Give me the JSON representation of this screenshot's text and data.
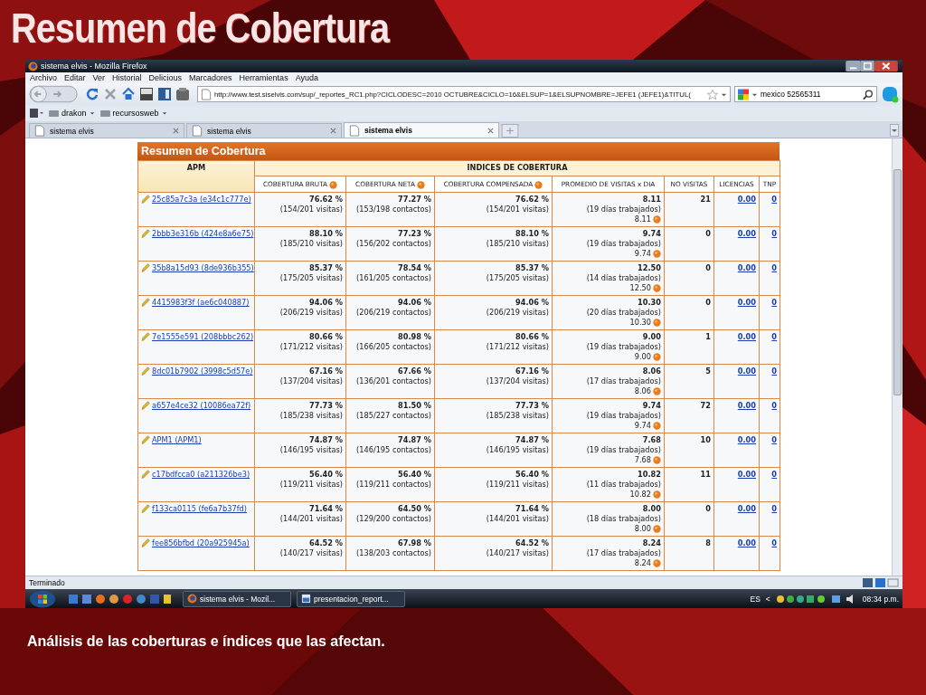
{
  "slide_title": "Resumen de Cobertura",
  "caption": "Análisis de las coberturas e índices que las afectan.",
  "browser": {
    "window_title": "sistema elvis - Mozilla Firefox",
    "menu": [
      "Archivo",
      "Editar",
      "Ver",
      "Historial",
      "Delicious",
      "Marcadores",
      "Herramientas",
      "Ayuda"
    ],
    "url": "http://www.test.siselvis.com/sup/_reportes_RC1.php?CICLODESC=2010 OCTUBRE&CICLO=16&ELSUP=1&ELSUPNOMBRE=JEFE1 (JEFE1)&TITUL(",
    "search": "mexico 52565311",
    "bookmarks": [
      "drakon",
      "recursosweb"
    ],
    "tabs": [
      {
        "label": "sistema elvis",
        "selected": false
      },
      {
        "label": "sistema elvis",
        "selected": false
      },
      {
        "label": "sistema elvis",
        "selected": true
      }
    ],
    "status": "Terminado"
  },
  "report": {
    "title": "Resumen de Cobertura",
    "apm_header": "APM",
    "group_header": "INDICES DE COBERTURA",
    "columns": [
      {
        "label": "COBERTURA BRUTA",
        "info": true
      },
      {
        "label": "COBERTURA NETA",
        "info": true
      },
      {
        "label": "COBERTURA COMPENSADA",
        "info": true
      },
      {
        "label": "PROMEDIO DE VISITAS x DIA",
        "info": false
      },
      {
        "label": "NO VISITAS",
        "info": false
      },
      {
        "label": "LICENCIAS",
        "info": false
      },
      {
        "label": "TNP",
        "info": false
      }
    ],
    "rows": [
      {
        "apm": "25c85a7c3a (e34c1c777e)",
        "bruta": "76.62 %",
        "bruta_detail": "(154/201 visitas)",
        "neta": "77.27 %",
        "neta_detail": "(153/198 contactos)",
        "compensada": "76.62 %",
        "compensada_detail": "(154/201 visitas)",
        "promedio": "8.11",
        "dias": "(19 días trabajados)",
        "promedio_repeat": "8.11",
        "no_visitas": "21",
        "licencias": "0.00",
        "tnp": "0"
      },
      {
        "apm": "2bbb3e316b (424e8a6e75)",
        "bruta": "88.10 %",
        "bruta_detail": "(185/210 visitas)",
        "neta": "77.23 %",
        "neta_detail": "(156/202 contactos)",
        "compensada": "88.10 %",
        "compensada_detail": "(185/210 visitas)",
        "promedio": "9.74",
        "dias": "(19 días trabajados)",
        "promedio_repeat": "9.74",
        "no_visitas": "0",
        "licencias": "0.00",
        "tnp": "0"
      },
      {
        "apm": "35b8a15d93 (8de936b355)",
        "bruta": "85.37 %",
        "bruta_detail": "(175/205 visitas)",
        "neta": "78.54 %",
        "neta_detail": "(161/205 contactos)",
        "compensada": "85.37 %",
        "compensada_detail": "(175/205 visitas)",
        "promedio": "12.50",
        "dias": "(14 días trabajados)",
        "promedio_repeat": "12.50",
        "no_visitas": "0",
        "licencias": "0.00",
        "tnp": "0"
      },
      {
        "apm": "4415983f3f (ae6c040887)",
        "bruta": "94.06 %",
        "bruta_detail": "(206/219 visitas)",
        "neta": "94.06 %",
        "neta_detail": "(206/219 contactos)",
        "compensada": "94.06 %",
        "compensada_detail": "(206/219 visitas)",
        "promedio": "10.30",
        "dias": "(20 días trabajados)",
        "promedio_repeat": "10.30",
        "no_visitas": "0",
        "licencias": "0.00",
        "tnp": "0"
      },
      {
        "apm": "7e1555e591 (208bbbc262)",
        "bruta": "80.66 %",
        "bruta_detail": "(171/212 visitas)",
        "neta": "80.98 %",
        "neta_detail": "(166/205 contactos)",
        "compensada": "80.66 %",
        "compensada_detail": "(171/212 visitas)",
        "promedio": "9.00",
        "dias": "(19 días trabajados)",
        "promedio_repeat": "9.00",
        "no_visitas": "1",
        "licencias": "0.00",
        "tnp": "0"
      },
      {
        "apm": "8dc01b7902 (3998c5d57e)",
        "bruta": "67.16 %",
        "bruta_detail": "(137/204 visitas)",
        "neta": "67.66 %",
        "neta_detail": "(136/201 contactos)",
        "compensada": "67.16 %",
        "compensada_detail": "(137/204 visitas)",
        "promedio": "8.06",
        "dias": "(17 días trabajados)",
        "promedio_repeat": "8.06",
        "no_visitas": "5",
        "licencias": "0.00",
        "tnp": "0"
      },
      {
        "apm": "a657e4ce32 (10086ea72f)",
        "bruta": "77.73 %",
        "bruta_detail": "(185/238 visitas)",
        "neta": "81.50 %",
        "neta_detail": "(185/227 contactos)",
        "compensada": "77.73 %",
        "compensada_detail": "(185/238 visitas)",
        "promedio": "9.74",
        "dias": "(19 días trabajados)",
        "promedio_repeat": "9.74",
        "no_visitas": "72",
        "licencias": "0.00",
        "tnp": "0"
      },
      {
        "apm": "APM1 (APM1)",
        "bruta": "74.87 %",
        "bruta_detail": "(146/195 visitas)",
        "neta": "74.87 %",
        "neta_detail": "(146/195 contactos)",
        "compensada": "74.87 %",
        "compensada_detail": "(146/195 visitas)",
        "promedio": "7.68",
        "dias": "(19 días trabajados)",
        "promedio_repeat": "7.68",
        "no_visitas": "10",
        "licencias": "0.00",
        "tnp": "0"
      },
      {
        "apm": "c17bdfcca0 (a211326be3)",
        "bruta": "56.40 %",
        "bruta_detail": "(119/211 visitas)",
        "neta": "56.40 %",
        "neta_detail": "(119/211 contactos)",
        "compensada": "56.40 %",
        "compensada_detail": "(119/211 visitas)",
        "promedio": "10.82",
        "dias": "(11 días trabajados)",
        "promedio_repeat": "10.82",
        "no_visitas": "11",
        "licencias": "0.00",
        "tnp": "0"
      },
      {
        "apm": "f133ca0115 (fe6a7b37fd)",
        "bruta": "71.64 %",
        "bruta_detail": "(144/201 visitas)",
        "neta": "64.50 %",
        "neta_detail": "(129/200 contactos)",
        "compensada": "71.64 %",
        "compensada_detail": "(144/201 visitas)",
        "promedio": "8.00",
        "dias": "(18 días trabajados)",
        "promedio_repeat": "8.00",
        "no_visitas": "0",
        "licencias": "0.00",
        "tnp": "0"
      },
      {
        "apm": "fee856bfbd (20a925945a)",
        "bruta": "64.52 %",
        "bruta_detail": "(140/217 visitas)",
        "neta": "67.98 %",
        "neta_detail": "(138/203 contactos)",
        "compensada": "64.52 %",
        "compensada_detail": "(140/217 visitas)",
        "promedio": "8.24",
        "dias": "(17 días trabajados)",
        "promedio_repeat": "8.24",
        "no_visitas": "8",
        "licencias": "0.00",
        "tnp": "0"
      }
    ]
  },
  "taskbar": {
    "windows": [
      {
        "label": "sistema elvis - Mozil...",
        "kind": "browser"
      },
      {
        "label": "presentacion_report...",
        "kind": "document"
      }
    ],
    "language": "ES",
    "tray_toggle": "<",
    "clock": "08:34 p.m."
  }
}
